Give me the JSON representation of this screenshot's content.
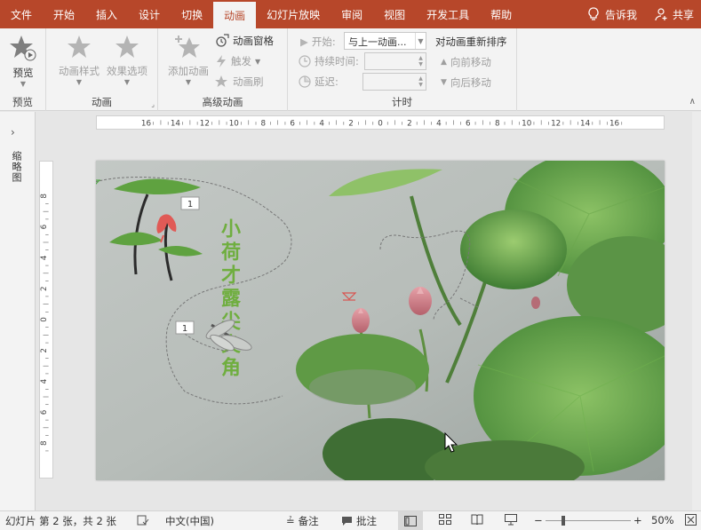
{
  "tabs": [
    {
      "label": "文件",
      "active": false
    },
    {
      "label": "开始",
      "active": false
    },
    {
      "label": "插入",
      "active": false
    },
    {
      "label": "设计",
      "active": false
    },
    {
      "label": "切换",
      "active": false
    },
    {
      "label": "动画",
      "active": true
    },
    {
      "label": "幻灯片放映",
      "active": false
    },
    {
      "label": "审阅",
      "active": false
    },
    {
      "label": "视图",
      "active": false
    },
    {
      "label": "开发工具",
      "active": false
    },
    {
      "label": "帮助",
      "active": false
    }
  ],
  "tell_me": "告诉我",
  "share": "共享",
  "ribbon": {
    "preview_group": {
      "label": "预览",
      "preview_button": "预览"
    },
    "animation_group": {
      "label": "动画",
      "styles_button": "动画样式",
      "effects_button": "效果选项"
    },
    "advanced_group": {
      "label": "高级动画",
      "add_button": "添加动画",
      "pane_button": "动画窗格",
      "trigger_button": "触发",
      "painter_button": "动画刷"
    },
    "timing_group": {
      "label": "计时",
      "start_label": "开始:",
      "start_value": "与上一动画...",
      "duration_label": "持续时间:",
      "delay_label": "延迟:",
      "reorder_label": "对动画重新排序",
      "move_earlier": "向前移动",
      "move_later": "向后移动"
    }
  },
  "thumbnail_pane": {
    "label": "缩略图"
  },
  "ruler": {
    "horizontal_ticks": [
      "16",
      "14",
      "12",
      "10",
      "8",
      "6",
      "4",
      "2",
      "0",
      "2",
      "4",
      "6",
      "8",
      "10",
      "12",
      "14",
      "16"
    ],
    "vertical_ticks": [
      "8",
      "6",
      "4",
      "2",
      "0",
      "2",
      "4",
      "6",
      "8"
    ]
  },
  "slide": {
    "title_vertical": "小荷才露尖尖角",
    "animation_tags": [
      "1",
      "1"
    ]
  },
  "status": {
    "slide_info": "幻灯片 第 2 张，共 2 张",
    "language": "中文(中国)",
    "notes": "备注",
    "comments": "批注",
    "zoom": "50%"
  },
  "colors": {
    "accent": "#b7472a",
    "ribbon_bg": "#f3f3f3",
    "lotus_leaf": "#6aa84f",
    "lotus_bud": "#d9828a",
    "title_green": "#6fae3f"
  }
}
